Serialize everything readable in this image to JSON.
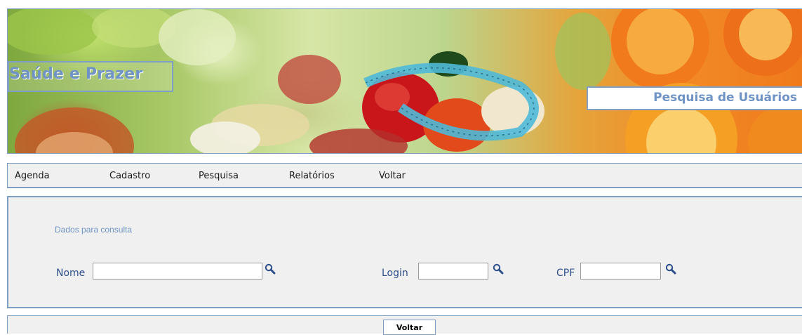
{
  "header": {
    "brand": "Saúde e Prazer",
    "page_title": "Pesquisa de Usuários"
  },
  "menu": {
    "items": [
      {
        "label": "Agenda"
      },
      {
        "label": "Cadastro"
      },
      {
        "label": "Pesquisa"
      },
      {
        "label": "Relatórios"
      },
      {
        "label": "Voltar"
      }
    ]
  },
  "search": {
    "section_label": "Dados para consulta",
    "fields": [
      {
        "label": "Nome",
        "value": "",
        "icon": "search-icon"
      },
      {
        "label": "Login",
        "value": "",
        "icon": "search-icon"
      },
      {
        "label": "CPF",
        "value": "",
        "icon": "search-icon"
      }
    ]
  },
  "footer": {
    "voltar_label": "Voltar"
  },
  "colors": {
    "accent": "#6f93c5",
    "border": "#7d9fc4",
    "panel_bg": "#f0f0f0",
    "label_text": "#2f4f8a"
  }
}
